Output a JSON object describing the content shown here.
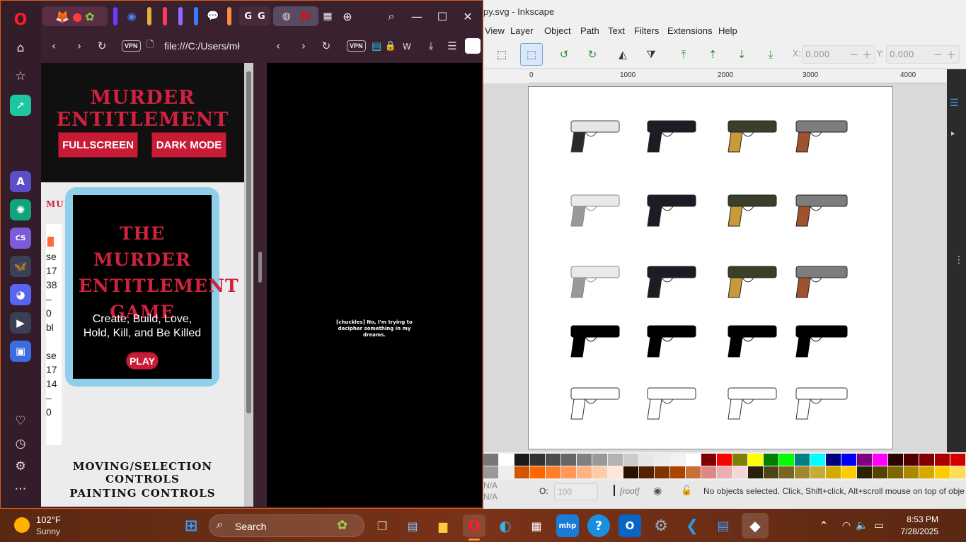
{
  "opera": {
    "sidebar": [
      {
        "name": "opera-logo-icon"
      },
      {
        "name": "home-icon"
      },
      {
        "name": "bookmarks-icon"
      },
      {
        "name": "aria-icon"
      },
      {
        "name": "aria-ai-icon"
      },
      {
        "name": "chatgpt-icon"
      },
      {
        "name": "cs-icon"
      },
      {
        "name": "bluesky-icon"
      },
      {
        "name": "discord-icon"
      },
      {
        "name": "player-icon"
      },
      {
        "name": "wallet-icon"
      }
    ],
    "left_url": "file:///C:/Users/mł",
    "vpn": "VPN",
    "right_toolbar_w": "W"
  },
  "game": {
    "title": "Murder Entitlement",
    "fullscreen": "FULLSCREEN",
    "darkmode": "DARK MODE",
    "side_label": "MURD",
    "side_lines": [
      "se",
      "17",
      "38",
      "–",
      "0",
      "bl",
      "se",
      "17",
      "14",
      "–",
      "0"
    ],
    "modal_title": "The Murder Entitlement Game",
    "modal_subtitle": "Create, Build, Love, Hold, Kill, and Be Killed",
    "play": "PLAY",
    "section1": "Moving/Selection Controls",
    "section2": "Painting Controls"
  },
  "video": {
    "caption": "[chuckles] No, I'm trying to decipher something in my dreams."
  },
  "inkscape": {
    "title": "py.svg - Inkscape",
    "menu": [
      "View",
      "Layer",
      "Object",
      "Path",
      "Text",
      "Filters",
      "Extensions",
      "Help"
    ],
    "x_label": "X:",
    "x_value": "0.000",
    "y_label": "Y:",
    "y_value": "0.000",
    "ruler": [
      "0",
      "1000",
      "2000",
      "3000",
      "4000"
    ],
    "status_na": "N/A",
    "opacity_label": "O:",
    "opacity_value": "100",
    "layer": "[root]",
    "status": "No objects selected. Click, Shift+click, Alt+scroll mouse on top of obje",
    "palette_row1": [
      "#777777",
      "#ffffff",
      "#1a1a1a",
      "#333333",
      "#4d4d4d",
      "#666666",
      "#808080",
      "#999999",
      "#b3b3b3",
      "#cccccc",
      "#e6e6e6",
      "#ececec",
      "#f2f2f2",
      "#ffffff",
      "#800000",
      "#ff0000",
      "#808000",
      "#ffff00",
      "#008000",
      "#00ff00",
      "#008080",
      "#00ffff",
      "#000080",
      "#0000ff",
      "#800080",
      "#ff00ff",
      "#2b0000",
      "#550000",
      "#800000",
      "#aa0000",
      "#d40000",
      "#ff0000"
    ],
    "palette_row2": [
      "#999999",
      "#eeeeee",
      "#d45500",
      "#ff6600",
      "#ff7f2a",
      "#ff9955",
      "#ffb380",
      "#ffccaa",
      "#ffe6d5",
      "#2b1100",
      "#552200",
      "#803300",
      "#aa4400",
      "#c87137",
      "#de8787",
      "#e9afaf",
      "#f4d7d7",
      "#28220b",
      "#504416",
      "#786721",
      "#a0892c",
      "#c8ab37",
      "#d4aa00",
      "#ffcc00",
      "#2b2200",
      "#554400",
      "#806600",
      "#aa8800",
      "#d4aa00",
      "#ffcc00",
      "#ffdd55",
      "#ffe680"
    ]
  },
  "taskbar": {
    "weather_temp": "102°F",
    "weather_desc": "Sunny",
    "search": "Search",
    "time": "8:53 PM",
    "date": "7/28/2025"
  }
}
